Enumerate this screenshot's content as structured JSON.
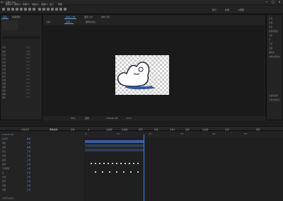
{
  "app": {
    "title": "Adobe After Effects - 小狗2.aep",
    "title_visible": "ffs - 小狗2.aep",
    "menu": [
      "帮助(H)",
      "图层(L)",
      "效果(T)",
      "动画(A)",
      "视图(V)",
      "窗口",
      "帮助"
    ],
    "window_controls": [
      "—",
      "□",
      "×"
    ]
  },
  "toolbar": {
    "workspace_tabs": [
      "默认",
      "标准",
      "小屏幕"
    ]
  },
  "viewer": {
    "tabs": [
      "合成 小狗",
      "图层 (无)",
      "素材 (无)"
    ],
    "breadcrumb": [
      "小狗",
      "合成 1",
      "猫咪(剪影)"
    ],
    "bottom_bar": [
      "50%",
      "完整",
      "0:00:01:02",
      "+0.0"
    ]
  },
  "left_panel": {
    "title": "项目",
    "tabs": [
      "项目",
      "效果控件"
    ],
    "columns": [
      "名称",
      "类型",
      "大小"
    ],
    "items": [
      {
        "name": "图层",
        "value": "合成"
      },
      {
        "name": "背景",
        "value": "PNG"
      },
      {
        "name": "背景",
        "value": "PNG"
      },
      {
        "name": "头部",
        "value": "PNG"
      },
      {
        "name": "身体",
        "value": "PNG"
      },
      {
        "name": "左臂",
        "value": "PNG"
      },
      {
        "name": "右臂",
        "value": "PNG"
      },
      {
        "name": "尾巴",
        "value": "PNG"
      },
      {
        "name": "左腿",
        "value": "PNG"
      },
      {
        "name": "右腿",
        "value": "PNG"
      },
      {
        "name": "滑板",
        "value": "PNG"
      },
      {
        "name": "阴影",
        "value": "PNG"
      },
      {
        "name": "眼睛",
        "value": "PNG"
      },
      {
        "name": "嘴巴",
        "value": "PNG"
      }
    ]
  },
  "right_panel": {
    "items": [
      "信息",
      "音频",
      "预览",
      "效果和预设",
      "对齐",
      "库",
      "字符",
      "段落",
      "跟踪器",
      "内容识别填充"
    ],
    "footer": [
      "来源的结果",
      "直到合成结束"
    ]
  },
  "timeline": {
    "tabs": [
      "渲染队列",
      "狗狗合成",
      "身体",
      "头",
      "左前腿",
      "右前腿",
      "尾巴",
      "耳朵",
      "身体2",
      "后腿",
      "右后腿",
      "头部",
      "阴影"
    ],
    "active_tab": "狗狗合成",
    "timecode": "0:00:01:02",
    "ruler": [
      "0s",
      "01s",
      "02s",
      "03s",
      "04s",
      "05s"
    ],
    "layers": [
      {
        "name": "源名称",
        "mode": "模式"
      },
      {
        "name": "狗狗",
        "mode": "正常"
      },
      {
        "name": "变换",
        "mode": "重置"
      },
      {
        "name": "锚点",
        "mode": "正常"
      },
      {
        "name": "位置",
        "mode": "正常"
      },
      {
        "name": "缩放",
        "mode": "正常"
      },
      {
        "name": "旋转",
        "mode": "正常"
      },
      {
        "name": "不透明度",
        "mode": "正常"
      },
      {
        "name": "头",
        "mode": "正常"
      },
      {
        "name": "身体",
        "mode": "正常"
      },
      {
        "name": "尾巴",
        "mode": "正常"
      },
      {
        "name": "后腿",
        "mode": "正常"
      },
      {
        "name": "前腿",
        "mode": "正常"
      }
    ],
    "footer": [
      "切换开关/模式"
    ]
  },
  "colors": {
    "accent": "#2c8cf0",
    "bar_blue": "#3a5f9c",
    "bar_dark": "#2d3d52",
    "bg": "#1d1d1d"
  }
}
